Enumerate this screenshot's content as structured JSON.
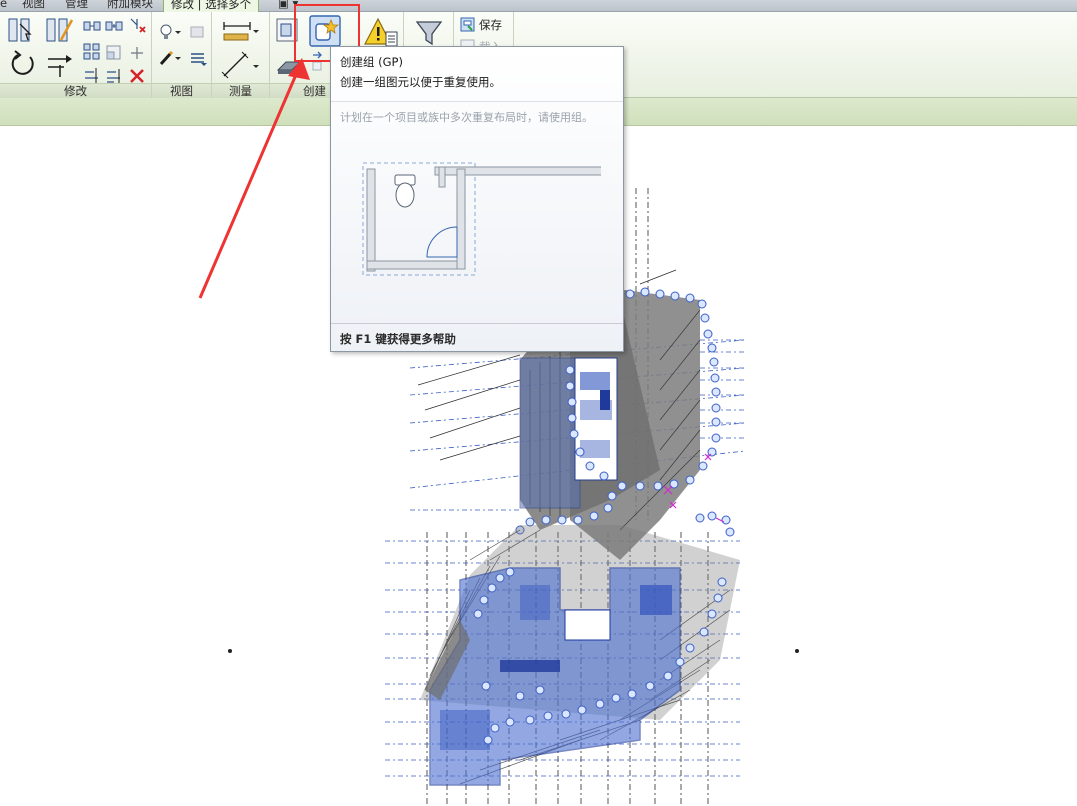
{
  "tabs": [
    {
      "label": "视图"
    },
    {
      "label": "管理"
    },
    {
      "label": "附加模块"
    },
    {
      "label": "修改 | 选择多个"
    }
  ],
  "ribbon": {
    "panels": {
      "modify": {
        "label": "修改"
      },
      "view": {
        "label": "视图"
      },
      "measure": {
        "label": "测量"
      },
      "create": {
        "label": "创建"
      }
    },
    "save_label": "保存",
    "load_label": "载入"
  },
  "tooltip": {
    "title": "创建组 (GP)",
    "description": "创建一组图元以便于重复使用。",
    "tip": "计划在一个项目或族中多次重复布局时，请使用组。",
    "help": "按 F1 键获得更多帮助"
  },
  "colors": {
    "highlight": "#ee3333",
    "selection_blue": "#3a5fc7",
    "ribbon_green": "#e7efdf"
  },
  "icons": {
    "create_group": "create-group-icon",
    "warning": "warning-icon",
    "filter": "filter-icon",
    "save": "save-selection-icon"
  }
}
